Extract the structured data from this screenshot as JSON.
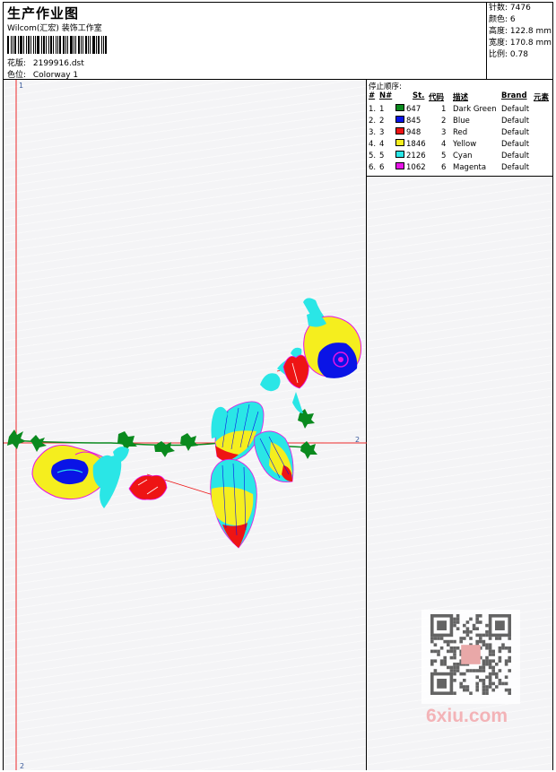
{
  "header": {
    "title": "生产作业图",
    "company": "Wilcom(汇宏) 装饰工作室",
    "design_label": "花版:",
    "design_value": "2199916.dst",
    "colorway_label": "色位:",
    "colorway_value": "Colorway 1"
  },
  "stats": {
    "stitches": "针数: 7476",
    "colors": "颜色: 6",
    "height": "高度: 122.8 mm",
    "width": "宽度: 170.8 mm",
    "scale": "比例: 0.78"
  },
  "axis_labels": {
    "top_one": "1",
    "bottom_two": "2",
    "right_two": "2"
  },
  "color_table": {
    "title": "停止顺序:",
    "headers": {
      "num": "#",
      "n": "N#",
      "st": "St.",
      "code": "代码",
      "desc": "描述",
      "brand": "Brand",
      "elem": "元素"
    },
    "rows": [
      {
        "num": "1.",
        "n": "1",
        "color": "#0a8a1e",
        "st": "647",
        "code": "1",
        "desc": "Dark Green",
        "brand": "Default"
      },
      {
        "num": "2.",
        "n": "2",
        "color": "#0a14e6",
        "st": "845",
        "code": "2",
        "desc": "Blue",
        "brand": "Default"
      },
      {
        "num": "3.",
        "n": "3",
        "color": "#ee1414",
        "st": "948",
        "code": "3",
        "desc": "Red",
        "brand": "Default"
      },
      {
        "num": "4.",
        "n": "4",
        "color": "#f5ee1e",
        "st": "1846",
        "code": "4",
        "desc": "Yellow",
        "brand": "Default"
      },
      {
        "num": "5.",
        "n": "5",
        "color": "#2ae6e6",
        "st": "2126",
        "code": "5",
        "desc": "Cyan",
        "brand": "Default"
      },
      {
        "num": "6.",
        "n": "6",
        "color": "#e614e6",
        "st": "1062",
        "code": "6",
        "desc": "Magenta",
        "brand": "Default"
      }
    ]
  },
  "watermark": {
    "text": "6xiu.com"
  }
}
